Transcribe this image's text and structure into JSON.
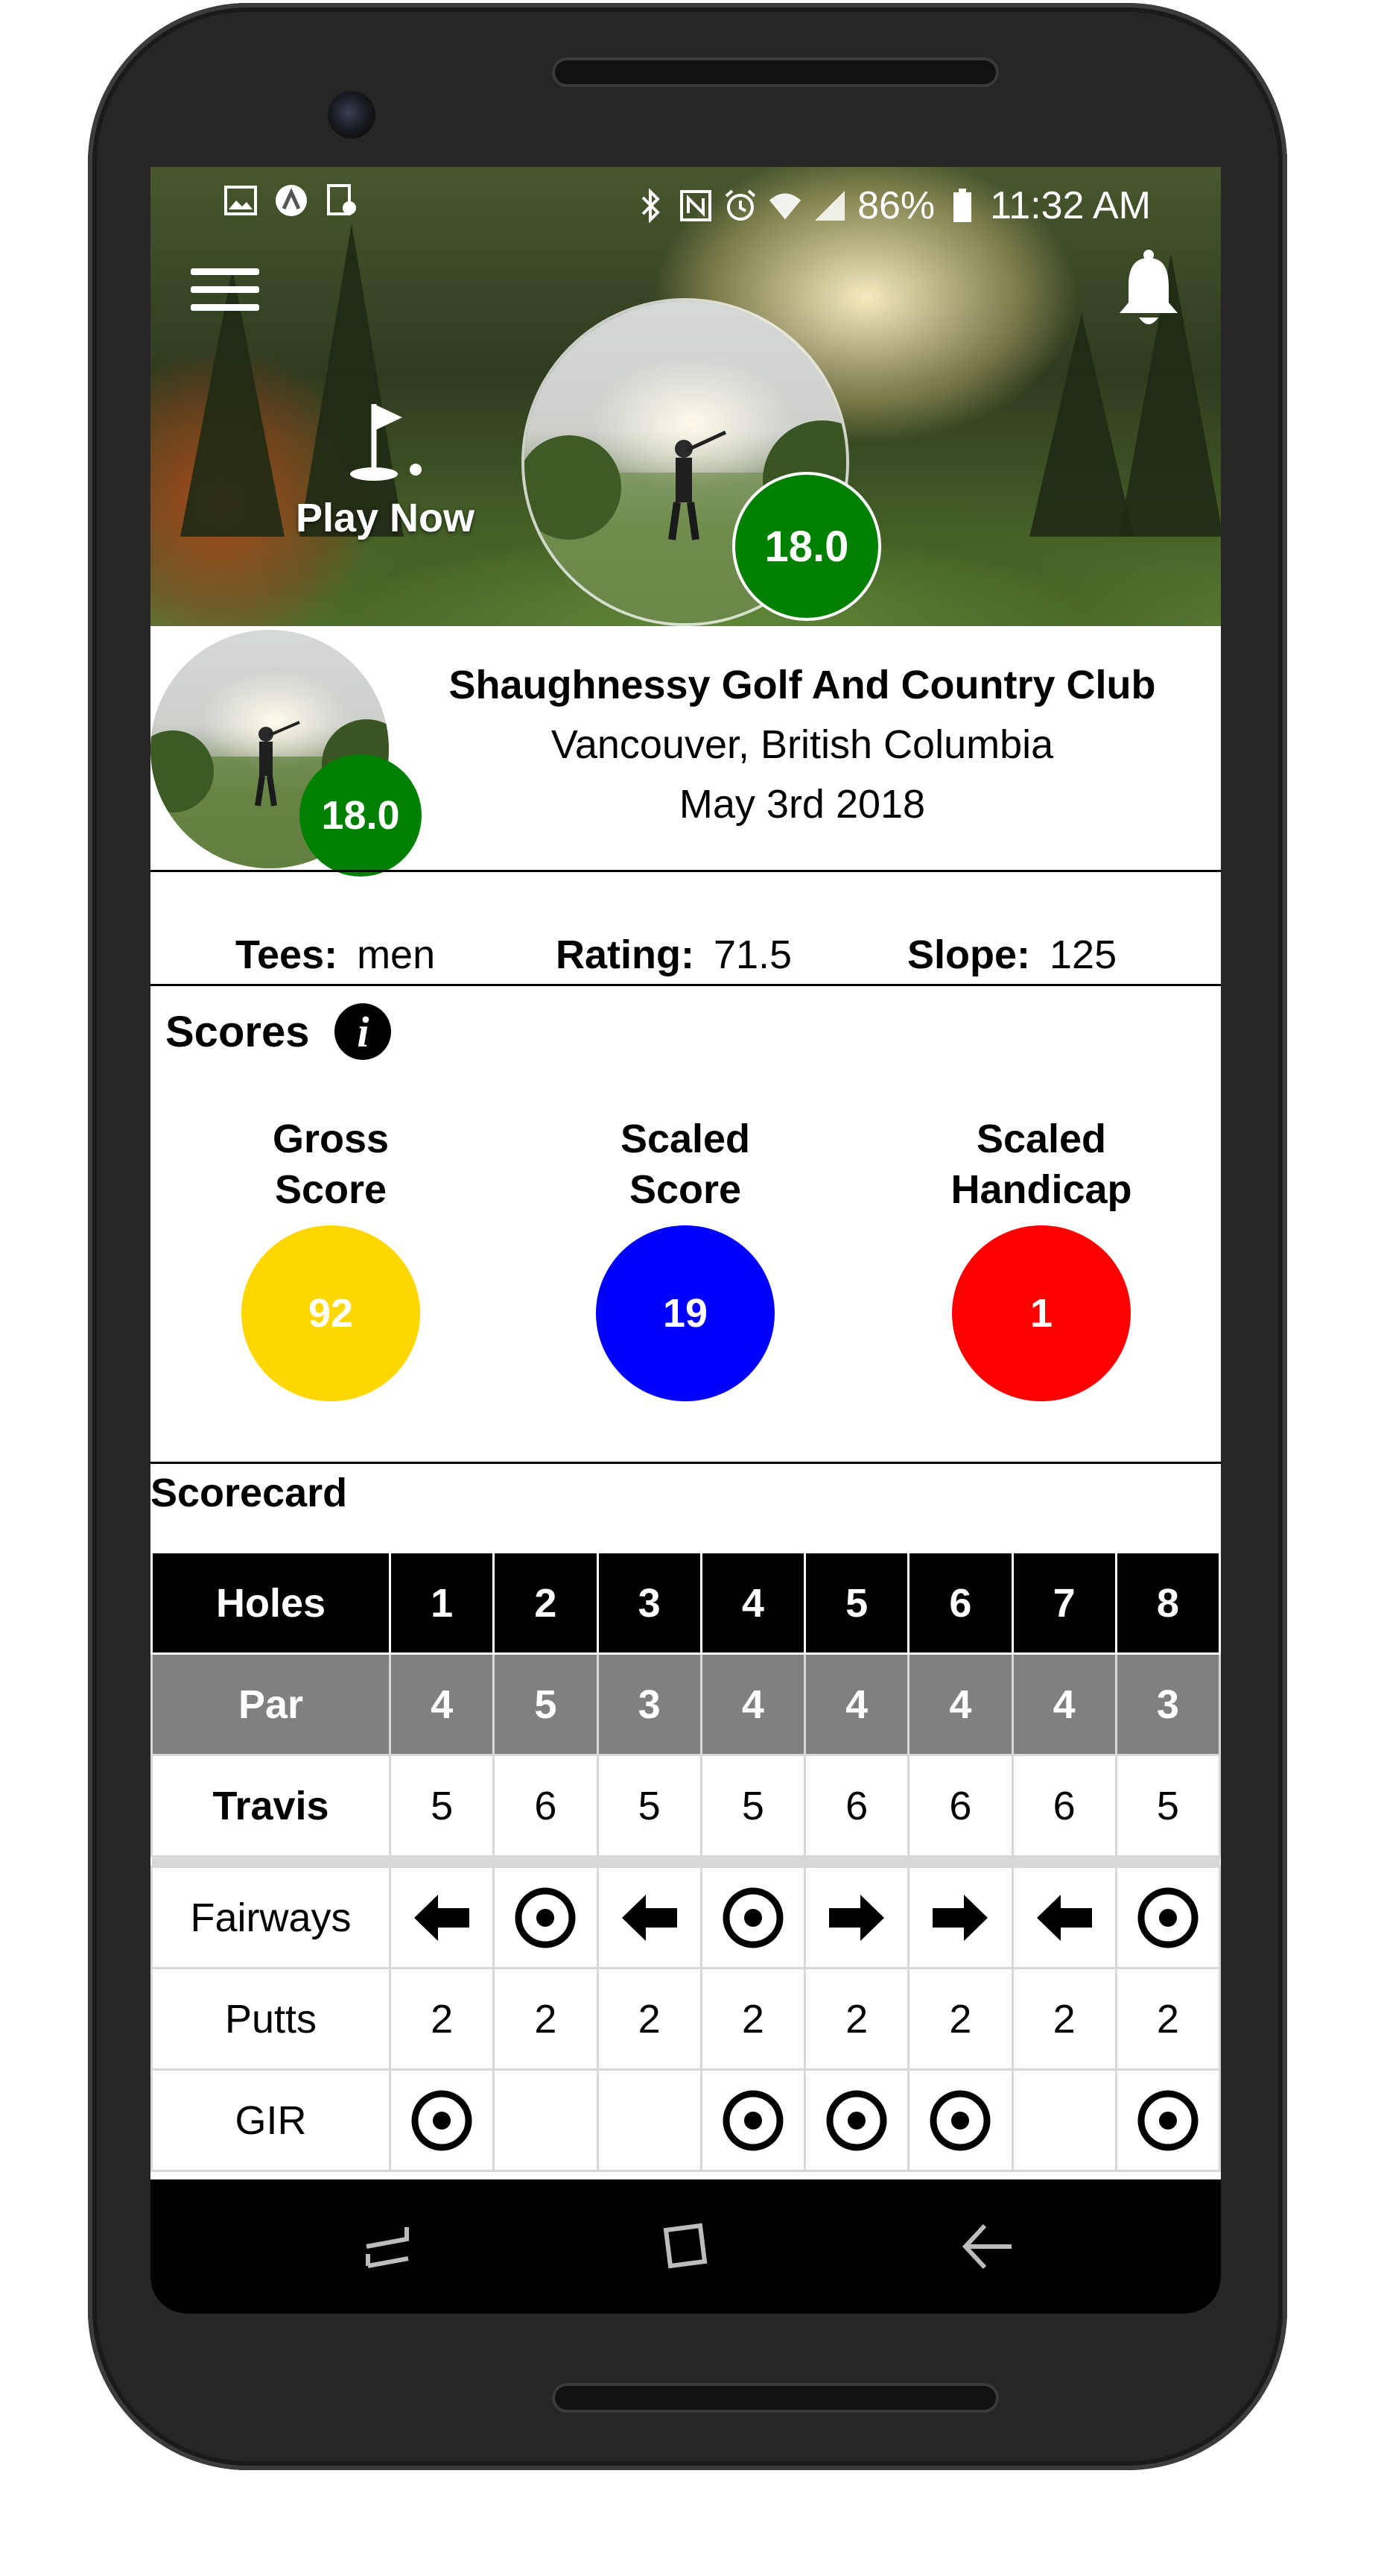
{
  "status_bar": {
    "battery": "86%",
    "time": "11:32 AM"
  },
  "hero": {
    "play_now_label": "Play Now",
    "handicap_badge": "18.0"
  },
  "course": {
    "handicap_badge": "18.0",
    "name": "Shaughnessy Golf And Country Club",
    "location": "Vancouver, British Columbia",
    "date": "May 3rd 2018"
  },
  "tees": {
    "tees_label": "Tees:",
    "tees_value": "men",
    "rating_label": "Rating:",
    "rating_value": "71.5",
    "slope_label": "Slope:",
    "slope_value": "125"
  },
  "scores": {
    "title": "Scores",
    "gross_label_1": "Gross",
    "gross_label_2": "Score",
    "gross_value": "92",
    "gross_color": "#FFD700",
    "scaled_label_1": "Scaled",
    "scaled_label_2": "Score",
    "scaled_value": "19",
    "scaled_color": "#0000FF",
    "handicap_label_1": "Scaled",
    "handicap_label_2": "Handicap",
    "handicap_value": "1",
    "handicap_color": "#FF0000"
  },
  "scorecard": {
    "title": "Scorecard",
    "holes_label": "Holes",
    "holes": [
      "1",
      "2",
      "3",
      "4",
      "5",
      "6",
      "7",
      "8"
    ],
    "par_label": "Par",
    "par": [
      "4",
      "5",
      "3",
      "4",
      "4",
      "4",
      "4",
      "3"
    ],
    "player_name": "Travis",
    "player_scores": [
      "5",
      "6",
      "5",
      "5",
      "6",
      "6",
      "6",
      "5"
    ],
    "fairways_label": "Fairways",
    "fairways": [
      "left-arrow-icon",
      "target-icon",
      "left-arrow-icon",
      "target-icon",
      "right-arrow-icon",
      "right-arrow-icon",
      "left-arrow-icon",
      "target-icon"
    ],
    "putts_label": "Putts",
    "putts": [
      "2",
      "2",
      "2",
      "2",
      "2",
      "2",
      "2",
      "2"
    ],
    "gir_label": "GIR",
    "gir": [
      "target-icon",
      "",
      "",
      "target-icon",
      "target-icon",
      "target-icon",
      "",
      "target-icon"
    ]
  }
}
